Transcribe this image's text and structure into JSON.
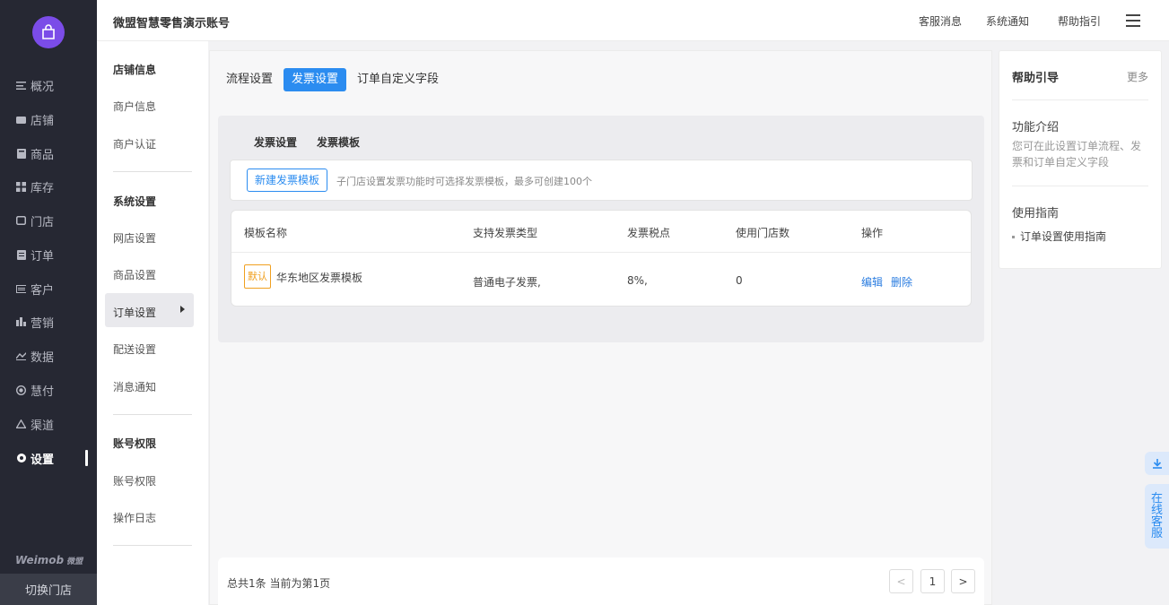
{
  "sidebar": {
    "items": [
      {
        "label": "概况",
        "icon": "menu-lines-icon"
      },
      {
        "label": "店铺",
        "icon": "store-icon"
      },
      {
        "label": "商品",
        "icon": "goods-icon"
      },
      {
        "label": "库存",
        "icon": "inventory-grid-icon"
      },
      {
        "label": "门店",
        "icon": "shop-icon"
      },
      {
        "label": "订单",
        "icon": "order-list-icon"
      },
      {
        "label": "客户",
        "icon": "customer-card-icon"
      },
      {
        "label": "营销",
        "icon": "bar-chart-icon"
      },
      {
        "label": "数据",
        "icon": "line-chart-icon"
      },
      {
        "label": "慧付",
        "icon": "pay-circle-icon"
      },
      {
        "label": "渠道",
        "icon": "channel-icon"
      },
      {
        "label": "设置",
        "icon": "gear-icon"
      }
    ],
    "active": "设置",
    "brand": "Weimob",
    "brand_cn": "微盟",
    "switch_store": "切换门店"
  },
  "header": {
    "account": "微盟智慧零售演示账号",
    "links": [
      "客服消息",
      "系统通知",
      "帮助指引"
    ]
  },
  "submenu": {
    "groups": [
      {
        "title": "店铺信息",
        "items": [
          "商户信息",
          "商户认证"
        ]
      },
      {
        "title": "系统设置",
        "items": [
          "网店设置",
          "商品设置",
          "订单设置",
          "配送设置",
          "消息通知"
        ]
      },
      {
        "title": "账号权限",
        "items": [
          "账号权限",
          "操作日志"
        ]
      }
    ],
    "active": "订单设置"
  },
  "tabs": [
    "流程设置",
    "发票设置",
    "订单自定义字段"
  ],
  "active_tab": "发票设置",
  "subtabs": [
    "发票设置",
    "发票模板"
  ],
  "new_template_button": "新建发票模板",
  "hint": "子门店设置发票功能时可选择发票模板，最多可创建100个",
  "table": {
    "headers": [
      "模板名称",
      "支持发票类型",
      "发票税点",
      "使用门店数",
      "操作"
    ],
    "rows": [
      {
        "badge": "默认",
        "name": "华东地区发票模板",
        "type": "普通电子发票,",
        "tax": "8%,",
        "stores": "0",
        "actions": [
          "编辑",
          "删除"
        ]
      }
    ]
  },
  "pagination": {
    "summary": "总共1条 当前为第1页",
    "prev": "<",
    "page": "1",
    "next": ">"
  },
  "help": {
    "title": "帮助引导",
    "more": "更多",
    "intro_title": "功能介绍",
    "intro_text": "您可在此设置订单流程、发票和订单自定义字段",
    "guide_title": "使用指南",
    "guide_item": "订单设置使用指南"
  },
  "float": {
    "service": "在线客服"
  },
  "colors": {
    "accent": "#2b8cf0",
    "sidebar_bg": "#262833",
    "logo": "#7b4ce8",
    "badge": "#f0a020"
  }
}
